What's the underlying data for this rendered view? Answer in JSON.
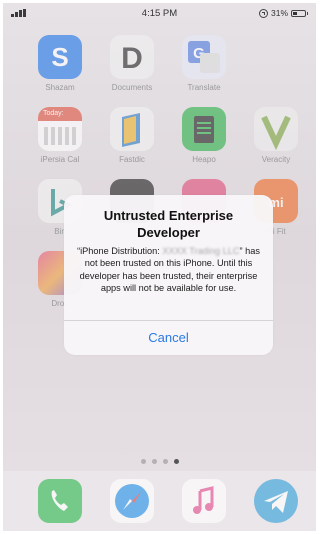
{
  "statusbar": {
    "time": "4:15 PM",
    "battery": "31%"
  },
  "apps": {
    "shazam": "Shazam",
    "documents": "Documents",
    "translate": "Translate",
    "ipersia": "iPersia Cal",
    "ipersia_badge": "Today:",
    "fastdic": "Fastdic",
    "heapo": "Heapo",
    "veracity": "Veracity",
    "bing": "Bin",
    "mi": "Mi Fit",
    "drop": "Drop",
    "mi_glyph": "mi"
  },
  "alert": {
    "title": "Untrusted Enterprise Developer",
    "msg_prefix": "“iPhone Distribution: ",
    "msg_redacted": "XXXX Trading LLC",
    "msg_suffix": "”",
    "msg_body": "has not been trusted on this iPhone. Until this developer has been trusted, their enterprise apps will not be available for use.",
    "cancel_label": "Cancel",
    "cancel_color": "#2a7ae2"
  },
  "page_dots": {
    "count": 4,
    "active": 4
  },
  "dock": [
    "phone-icon",
    "safari-icon",
    "music-icon",
    "telegram-icon"
  ]
}
